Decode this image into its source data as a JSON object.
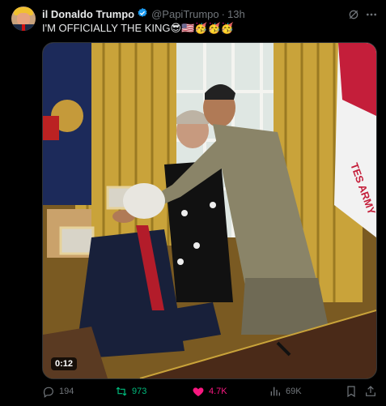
{
  "author": {
    "display_name": "il Donaldo Trumpo",
    "handle": "@PapiTrumpo",
    "separator": "·",
    "time": "13h",
    "verified_icon": "verified-badge-icon"
  },
  "tweet": {
    "text": "I'M OFFICIALLY THE KING😎🇺🇸🥳🥳🥳"
  },
  "media": {
    "duration": "0:12",
    "flag_text": "TES ARMY"
  },
  "actions": {
    "replies": "194",
    "reposts": "973",
    "likes": "4.7K",
    "views": "69K"
  },
  "colors": {
    "background": "#000000",
    "text_primary": "#e7e9ea",
    "text_secondary": "#71767b",
    "verified": "#1d9bf0",
    "repost_active": "#00ba7c",
    "like_active": "#f91880"
  }
}
